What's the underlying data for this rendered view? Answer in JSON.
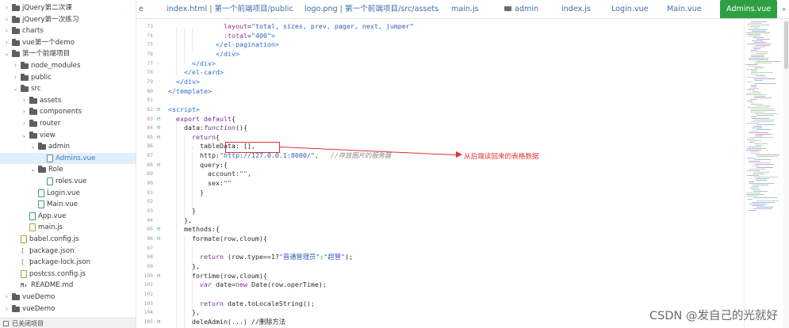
{
  "sidebar": {
    "items": [
      {
        "label": "jQuery第二次课",
        "depth": 0,
        "chevron": "›",
        "icon": "folder"
      },
      {
        "label": "jQuery第一次练习",
        "depth": 0,
        "chevron": "›",
        "icon": "folder"
      },
      {
        "label": "charts",
        "depth": 0,
        "chevron": "›",
        "icon": "folder"
      },
      {
        "label": "vue第一个demo",
        "depth": 0,
        "chevron": "›",
        "icon": "folder"
      },
      {
        "label": "第一个前端项目",
        "depth": 0,
        "chevron": "⌄",
        "icon": "folder"
      },
      {
        "label": "node_modules",
        "depth": 1,
        "chevron": "›",
        "icon": "folder"
      },
      {
        "label": "public",
        "depth": 1,
        "chevron": "›",
        "icon": "folder"
      },
      {
        "label": "src",
        "depth": 1,
        "chevron": "⌄",
        "icon": "folder"
      },
      {
        "label": "assets",
        "depth": 2,
        "chevron": "›",
        "icon": "folder"
      },
      {
        "label": "components",
        "depth": 2,
        "chevron": "›",
        "icon": "folder"
      },
      {
        "label": "router",
        "depth": 2,
        "chevron": "›",
        "icon": "folder"
      },
      {
        "label": "view",
        "depth": 2,
        "chevron": "⌄",
        "icon": "folder"
      },
      {
        "label": "admin",
        "depth": 3,
        "chevron": "⌄",
        "icon": "folder"
      },
      {
        "label": "Admins.vue",
        "depth": 4,
        "chevron": "",
        "icon": "vue",
        "selected": true
      },
      {
        "label": "Role",
        "depth": 3,
        "chevron": "⌄",
        "icon": "folder"
      },
      {
        "label": "roles.vue",
        "depth": 4,
        "chevron": "",
        "icon": "vue"
      },
      {
        "label": "Login.vue",
        "depth": 3,
        "chevron": "",
        "icon": "vue"
      },
      {
        "label": "Main.vue",
        "depth": 3,
        "chevron": "",
        "icon": "vue"
      },
      {
        "label": "App.vue",
        "depth": 2,
        "chevron": "",
        "icon": "vue"
      },
      {
        "label": "main.js",
        "depth": 2,
        "chevron": "",
        "icon": "js"
      },
      {
        "label": "babel.config.js",
        "depth": 1,
        "chevron": "",
        "icon": "js"
      },
      {
        "label": "package.json",
        "depth": 1,
        "chevron": "",
        "icon": "json"
      },
      {
        "label": "package-lock.json",
        "depth": 1,
        "chevron": "",
        "icon": "json"
      },
      {
        "label": "postcss.config.js",
        "depth": 1,
        "chevron": "",
        "icon": "js"
      },
      {
        "label": "README.md",
        "depth": 1,
        "chevron": "",
        "icon": "md"
      },
      {
        "label": "vueDemo",
        "depth": 0,
        "chevron": "›",
        "icon": "folder"
      },
      {
        "label": "vueDemo",
        "depth": 0,
        "chevron": "›",
        "icon": "folder"
      }
    ],
    "status": "已关闭项目"
  },
  "tabs": [
    {
      "label": "e",
      "icon": ""
    },
    {
      "label": "index.html | 第一个前端项目/public",
      "icon": ""
    },
    {
      "label": "logo.png | 第一个前端项目/src/assets",
      "icon": ""
    },
    {
      "label": "main.js",
      "icon": ""
    },
    {
      "label": "admin",
      "icon": "folder"
    },
    {
      "label": "index.js",
      "icon": ""
    },
    {
      "label": "Login.vue",
      "icon": ""
    },
    {
      "label": "Main.vue",
      "icon": ""
    },
    {
      "label": "Admins.vue",
      "icon": "",
      "active": true
    }
  ],
  "tab_overflow": "»",
  "code_lines": [
    {
      "n": "73",
      "fold": "",
      "indent": 14,
      "segs": [
        [
          "attr",
          "layout"
        ],
        [
          "plain",
          "="
        ],
        [
          "str",
          "\"total, sizes, prev, pager, next, jumper\""
        ]
      ]
    },
    {
      "n": "74",
      "fold": "",
      "indent": 14,
      "segs": [
        [
          "attr",
          ":total"
        ],
        [
          "plain",
          "="
        ],
        [
          "str",
          "\"400\""
        ],
        [
          "tag",
          ">"
        ]
      ]
    },
    {
      "n": "75",
      "fold": "",
      "indent": 12,
      "segs": [
        [
          "tag",
          "</el-pagination>"
        ]
      ]
    },
    {
      "n": "76",
      "fold": "",
      "indent": 12,
      "segs": [
        [
          "tag",
          "</div>"
        ]
      ]
    },
    {
      "n": "77",
      "fold": "-",
      "indent": 6,
      "segs": [
        [
          "tag",
          "</div>"
        ]
      ]
    },
    {
      "n": "78",
      "fold": "-",
      "indent": 4,
      "segs": [
        [
          "tag",
          "</el-card>"
        ]
      ]
    },
    {
      "n": "79",
      "fold": "-",
      "indent": 2,
      "segs": [
        [
          "tag",
          "</div>"
        ]
      ]
    },
    {
      "n": "80",
      "fold": "",
      "indent": 0,
      "segs": [
        [
          "tag",
          "</template>"
        ]
      ]
    },
    {
      "n": "81",
      "fold": "",
      "indent": 0,
      "segs": []
    },
    {
      "n": "82",
      "fold": "⊟",
      "indent": 0,
      "segs": [
        [
          "tag",
          "<script>"
        ]
      ]
    },
    {
      "n": "83",
      "fold": "⊟",
      "indent": 2,
      "segs": [
        [
          "kw",
          "export"
        ],
        [
          "plain",
          " "
        ],
        [
          "kw",
          "default"
        ],
        [
          "plain",
          "{"
        ]
      ]
    },
    {
      "n": "84",
      "fold": "⊟",
      "indent": 4,
      "segs": [
        [
          "plain",
          "data:"
        ],
        [
          "kwi",
          "function"
        ],
        [
          "plain",
          "(){"
        ]
      ]
    },
    {
      "n": "85",
      "fold": "⊟",
      "indent": 6,
      "segs": [
        [
          "kw",
          "return"
        ],
        [
          "plain",
          "{"
        ]
      ]
    },
    {
      "n": "86",
      "fold": "",
      "indent": 8,
      "segs": [
        [
          "plain",
          "tableData: [],"
        ]
      ]
    },
    {
      "n": "87",
      "fold": "",
      "indent": 8,
      "segs": [
        [
          "plain",
          "http:"
        ],
        [
          "str",
          "\"http://127.0.0.1:8000/\""
        ],
        [
          "plain",
          ",   "
        ],
        [
          "cmt",
          "//存放图片的服务器"
        ]
      ]
    },
    {
      "n": "88",
      "fold": "⊟",
      "indent": 8,
      "segs": [
        [
          "plain",
          "query:{"
        ]
      ]
    },
    {
      "n": "89",
      "fold": "",
      "indent": 10,
      "segs": [
        [
          "plain",
          "account:"
        ],
        [
          "str",
          "\"\""
        ],
        [
          "plain",
          ","
        ]
      ]
    },
    {
      "n": "90",
      "fold": "",
      "indent": 10,
      "segs": [
        [
          "plain",
          "sex:"
        ],
        [
          "str",
          "\"\""
        ]
      ]
    },
    {
      "n": "91",
      "fold": "",
      "indent": 8,
      "segs": [
        [
          "plain",
          "}"
        ]
      ]
    },
    {
      "n": "92",
      "fold": "",
      "indent": 0,
      "segs": []
    },
    {
      "n": "93",
      "fold": "",
      "indent": 6,
      "segs": [
        [
          "plain",
          "}"
        ]
      ]
    },
    {
      "n": "94",
      "fold": "",
      "indent": 4,
      "segs": [
        [
          "plain",
          "},"
        ]
      ]
    },
    {
      "n": "95",
      "fold": "⊟",
      "indent": 4,
      "segs": [
        [
          "plain",
          "methods:{"
        ]
      ]
    },
    {
      "n": "96",
      "fold": "⊟",
      "indent": 6,
      "segs": [
        [
          "plain",
          "formate(row,cloum){"
        ]
      ]
    },
    {
      "n": "97",
      "fold": "",
      "indent": 0,
      "segs": []
    },
    {
      "n": "98",
      "fold": "",
      "indent": 8,
      "segs": [
        [
          "kw",
          "return"
        ],
        [
          "plain",
          " (row.type=="
        ],
        [
          "num",
          "1"
        ],
        [
          "plain",
          "?"
        ],
        [
          "str",
          "\"普通管理员\""
        ],
        [
          "plain",
          ":"
        ],
        [
          "str",
          "\"超管\""
        ],
        [
          "plain",
          ");"
        ]
      ]
    },
    {
      "n": "99",
      "fold": "",
      "indent": 6,
      "segs": [
        [
          "plain",
          "},"
        ]
      ]
    },
    {
      "n": "100",
      "fold": "⊟",
      "indent": 6,
      "segs": [
        [
          "plain",
          "fortime(row,cloum){"
        ]
      ]
    },
    {
      "n": "101",
      "fold": "",
      "indent": 8,
      "segs": [
        [
          "kwi",
          "var"
        ],
        [
          "plain",
          " date="
        ],
        [
          "kw",
          "new"
        ],
        [
          "plain",
          " Date(row.operTime);"
        ]
      ]
    },
    {
      "n": "102",
      "fold": "",
      "indent": 0,
      "segs": []
    },
    {
      "n": "103",
      "fold": "",
      "indent": 8,
      "segs": [
        [
          "kw",
          "return"
        ],
        [
          "plain",
          " date.toLocaleString();"
        ]
      ]
    },
    {
      "n": "104",
      "fold": "",
      "indent": 6,
      "segs": [
        [
          "plain",
          "},"
        ]
      ]
    },
    {
      "n": "105",
      "fold": "⊟",
      "indent": 6,
      "segs": [
        [
          "plain",
          "deleAdmin(...) //删除方法"
        ]
      ]
    }
  ],
  "annotation": {
    "text": "从后端读回来的表格数据",
    "color": "#e03232"
  },
  "watermark": "CSDN @发自己的光就好",
  "colors": {
    "active_tab": "#2ea043",
    "selected_row": "#e1eefb",
    "tag": "#2e6fc4",
    "attr": "#9b2fa8",
    "string": "#2f5fb4",
    "keyword": "#7a2f93",
    "comment": "#8a8a8a",
    "annotation": "#e03232"
  },
  "icons": {
    "folder": "folder-icon",
    "vue": "vue-file-icon",
    "js": "js-file-icon",
    "json": "json-file-icon",
    "md": "markdown-file-icon",
    "fold": "fold-toggle-icon",
    "chevron_right": "chevron-right-icon",
    "chevron_down": "chevron-down-icon"
  }
}
